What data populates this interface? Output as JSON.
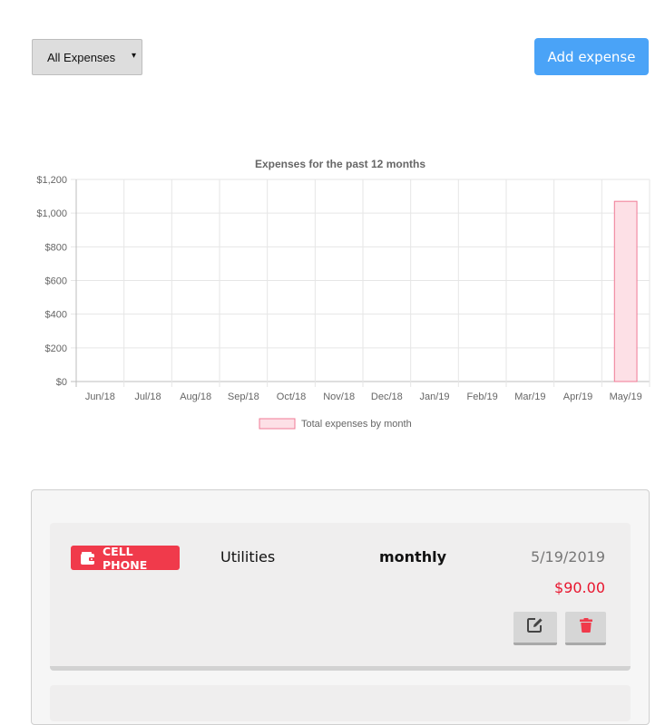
{
  "filter": {
    "selected": "All Expenses",
    "caret": "▾"
  },
  "add_button": {
    "label": "Add expense"
  },
  "chart_data": {
    "type": "bar",
    "title": "Expenses for the past 12 months",
    "categories": [
      "Jun/18",
      "Jul/18",
      "Aug/18",
      "Sep/18",
      "Oct/18",
      "Nov/18",
      "Dec/18",
      "Jan/19",
      "Feb/19",
      "Mar/19",
      "Apr/19",
      "May/19"
    ],
    "series": [
      {
        "name": "Total expenses by month",
        "values": [
          0,
          0,
          0,
          0,
          0,
          0,
          0,
          0,
          0,
          0,
          0,
          1070
        ]
      }
    ],
    "y_ticks": [
      "$0",
      "$200",
      "$400",
      "$600",
      "$800",
      "$1,000",
      "$1,200"
    ],
    "ylim": [
      0,
      1200
    ],
    "grid": true,
    "legend": "bottom",
    "colors": {
      "bar_fill": "#fde0e6",
      "bar_stroke": "#f07a95",
      "grid": "#e6e6e6",
      "text": "#666666"
    }
  },
  "expenses": [
    {
      "category_badge": "CELL PHONE",
      "category": "Utilities",
      "frequency": "monthly",
      "date": "5/19/2019",
      "amount": "$90.00",
      "badge_icon": "wallet-icon",
      "actions": {
        "edit_icon": "edit-icon",
        "delete_icon": "trash-icon"
      }
    }
  ],
  "colors": {
    "accent": "#4aa3f7",
    "badge": "#f03a4b",
    "amount": "#e8152e",
    "delete_icon": "#f03a4b"
  }
}
